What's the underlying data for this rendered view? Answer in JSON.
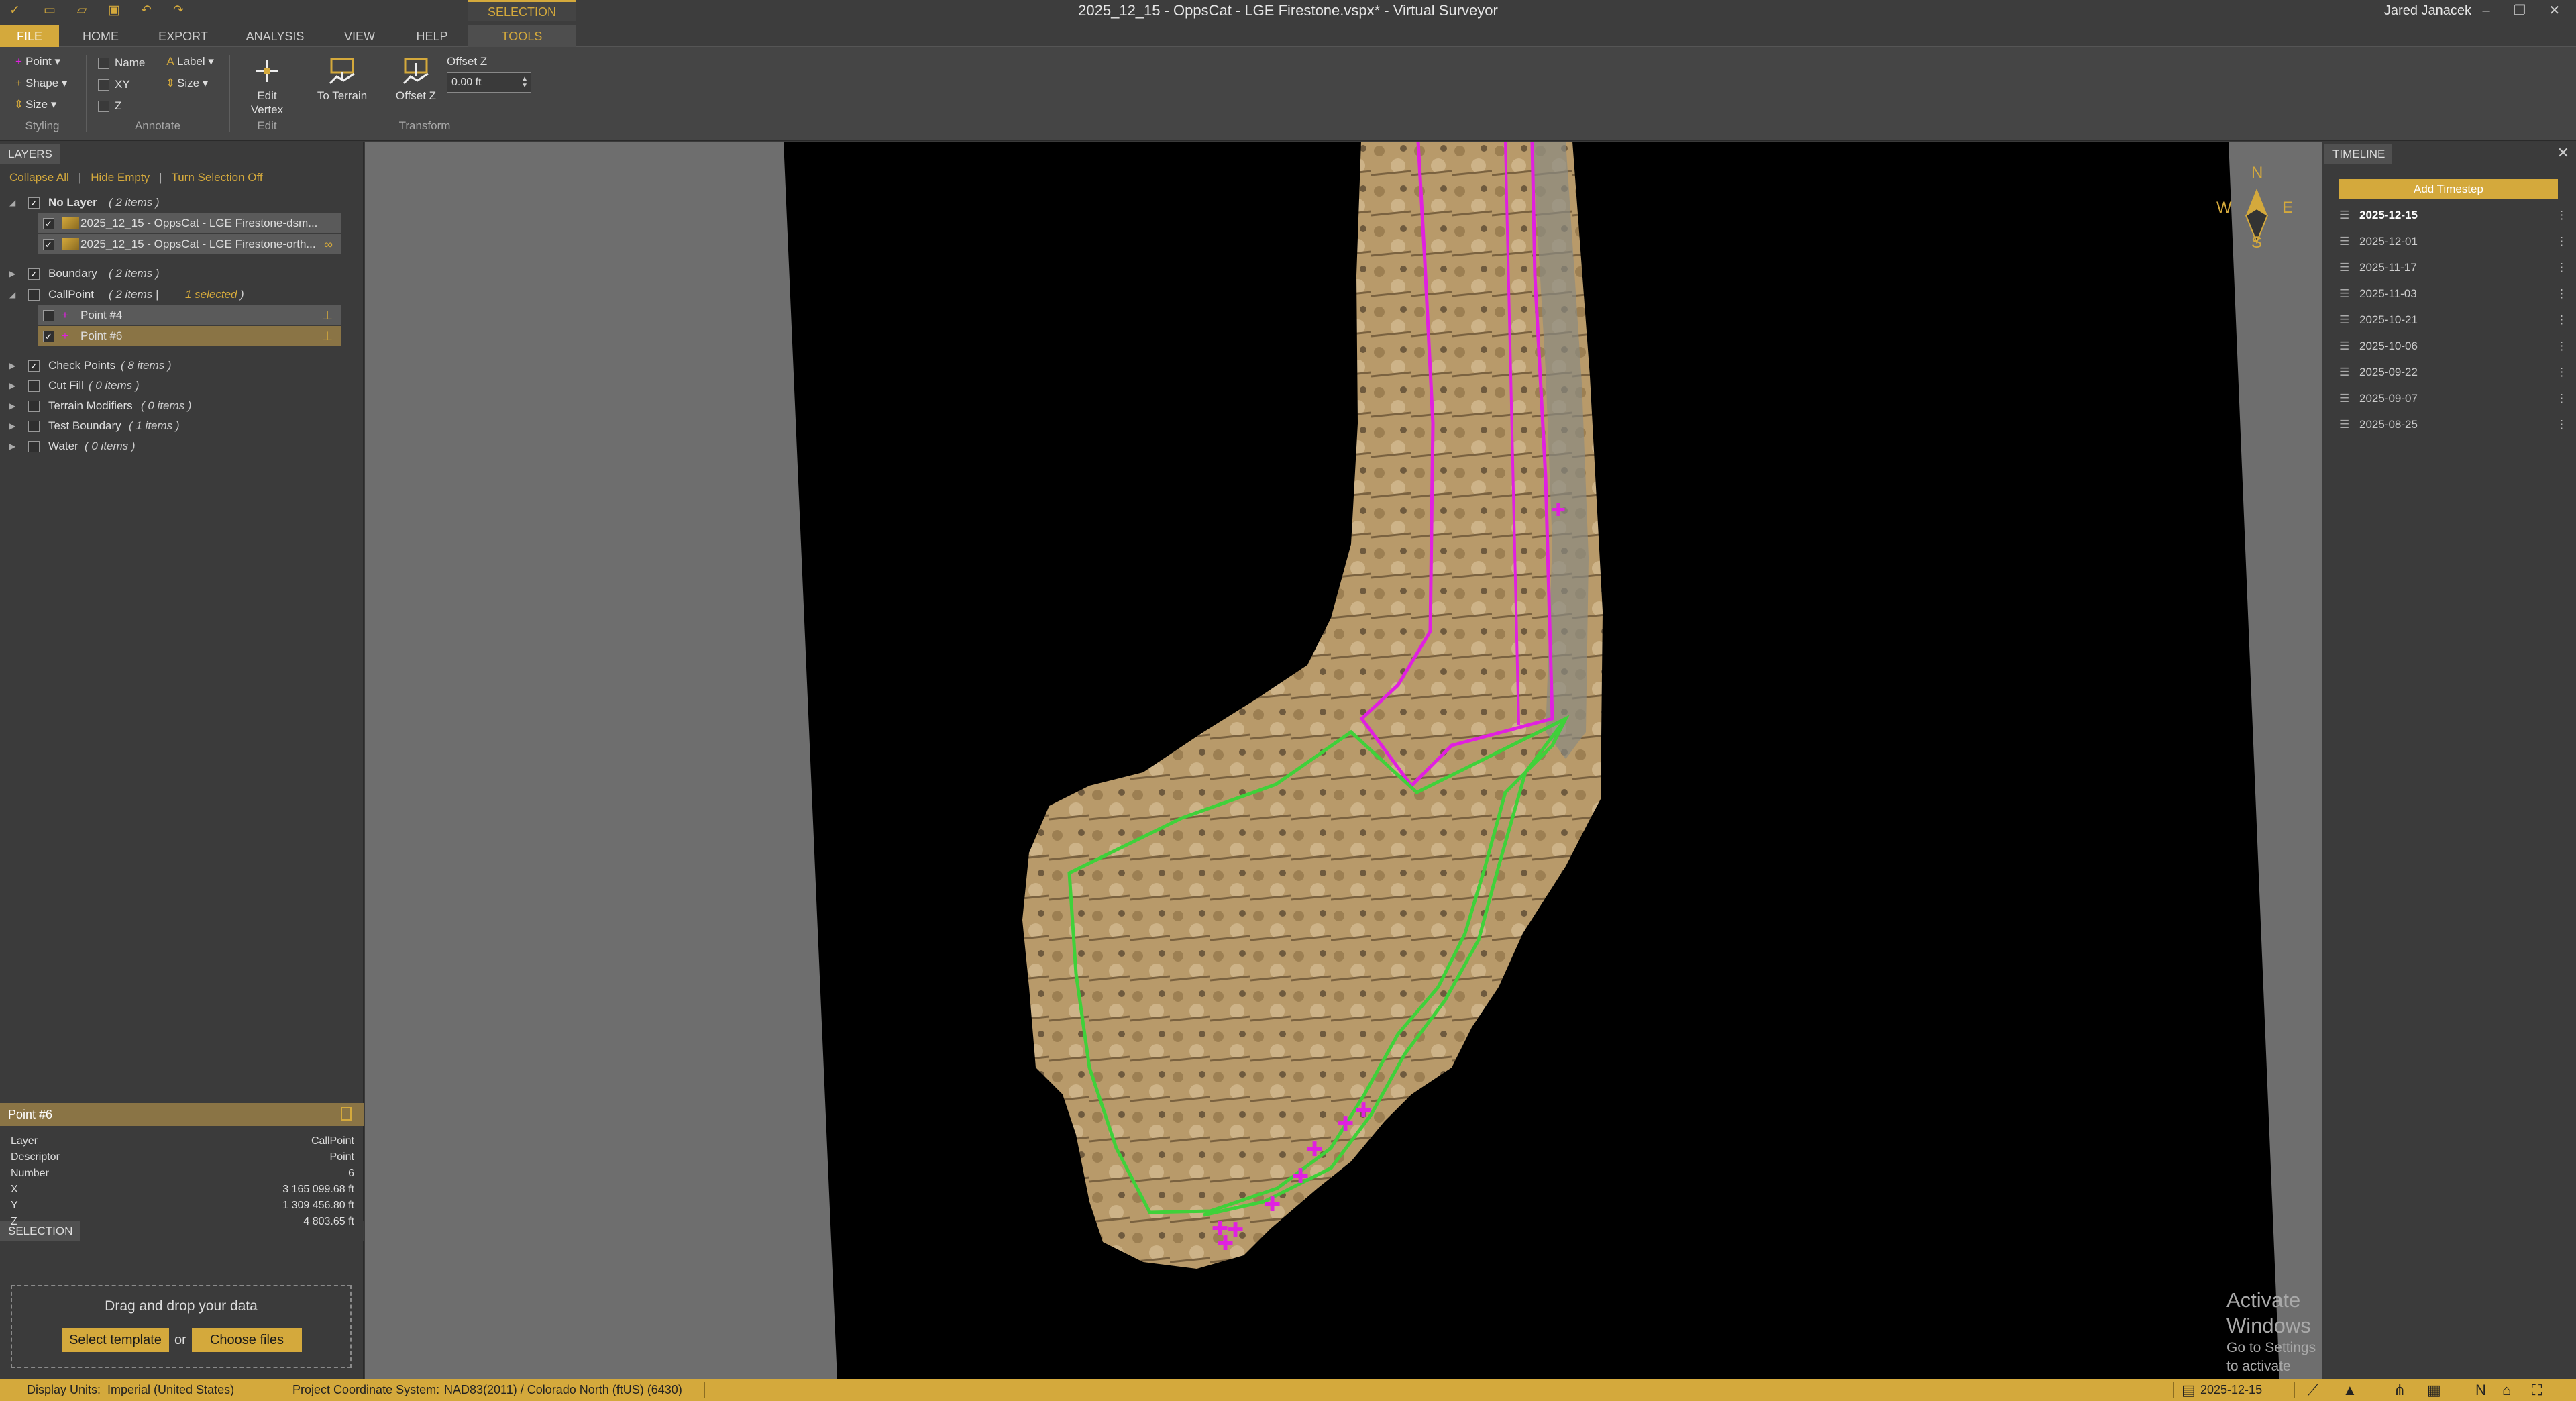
{
  "window": {
    "title": "2025_12_15 - OppsCat - LGE Firestone.vspx* - Virtual Surveyor",
    "user": "Jared Janacek"
  },
  "ribbon": {
    "contextual_group": "SELECTION",
    "tabs": [
      "FILE",
      "HOME",
      "EXPORT",
      "ANALYSIS",
      "VIEW",
      "HELP",
      "TOOLS"
    ],
    "active_tab": "TOOLS",
    "styling": {
      "point": "Point",
      "shape": "Shape",
      "size": "Size",
      "label": "Styling"
    },
    "annotate": {
      "name": "Name",
      "xy": "XY",
      "z": "Z",
      "label_btn": "Label",
      "size": "Size",
      "label": "Annotate"
    },
    "edit": {
      "edit_vertex": "Edit Vertex",
      "label": "Edit"
    },
    "transform": {
      "to_terrain": "To Terrain",
      "offset_z_btn": "Offset Z",
      "offset_z_label": "Offset Z",
      "offset_z_value": "0.00 ft",
      "label": "Transform"
    }
  },
  "layers": {
    "header": "LAYERS",
    "actions": {
      "collapse_all": "Collapse All",
      "hide_empty": "Hide Empty",
      "turn_selection_off": "Turn Selection Off"
    },
    "no_layer": {
      "label": "No Layer",
      "count": "( 2 items )"
    },
    "rasters": [
      "2025_12_15 - OppsCat - LGE Firestone-dsm...",
      "2025_12_15 - OppsCat - LGE Firestone-orth..."
    ],
    "boundary": {
      "label": "Boundary",
      "count": "( 2 items )"
    },
    "callpoint": {
      "label": "CallPoint",
      "count": "( 2 items |",
      "selected": "1 selected",
      "close": ")"
    },
    "points": [
      "Point #4",
      "Point #6"
    ],
    "others": [
      {
        "label": "Check Points",
        "count": "( 8 items )",
        "checked": true
      },
      {
        "label": "Cut Fill",
        "count": "( 0 items )",
        "checked": false
      },
      {
        "label": "Terrain Modifiers",
        "count": "( 0 items )",
        "checked": false
      },
      {
        "label": "Test Boundary",
        "count": "( 1 items )",
        "checked": false
      },
      {
        "label": "Water",
        "count": "( 0 items )",
        "checked": false
      }
    ]
  },
  "selection": {
    "header": "SELECTION",
    "title": "Point #6",
    "properties": [
      {
        "key": "Layer",
        "value": "CallPoint"
      },
      {
        "key": "Descriptor",
        "value": "Point"
      },
      {
        "key": "Number",
        "value": "6"
      },
      {
        "key": "X",
        "value": "3 165 099.68 ft"
      },
      {
        "key": "Y",
        "value": "1 309 456.80 ft"
      },
      {
        "key": "Z",
        "value": "4 803.65 ft"
      }
    ]
  },
  "dropzone": {
    "text": "Drag and drop your data",
    "select_template": "Select template",
    "or": "or",
    "choose_files": "Choose files"
  },
  "compass": {
    "n": "N",
    "s": "S",
    "e": "E",
    "w": "W"
  },
  "activate_windows": {
    "title": "Activate Windows",
    "subtitle": "Go to Settings to activate Windows."
  },
  "timeline": {
    "header": "TIMELINE",
    "add_timestep": "Add Timestep",
    "dates": [
      "2025-12-15",
      "2025-12-01",
      "2025-11-17",
      "2025-11-03",
      "2025-10-21",
      "2025-10-06",
      "2025-09-22",
      "2025-09-07",
      "2025-08-25"
    ],
    "current": "2025-12-15"
  },
  "status": {
    "display_units_label": "Display Units:",
    "display_units": "Imperial (United States)",
    "crs_label": "Project Coordinate System:",
    "crs": "NAD83(2011) / Colorado North (ftUS) (6430)",
    "date": "2025-12-15"
  },
  "colors": {
    "accent": "#d4a93c",
    "boundary_green": "#3fd13a",
    "path_magenta": "#e020e0"
  }
}
